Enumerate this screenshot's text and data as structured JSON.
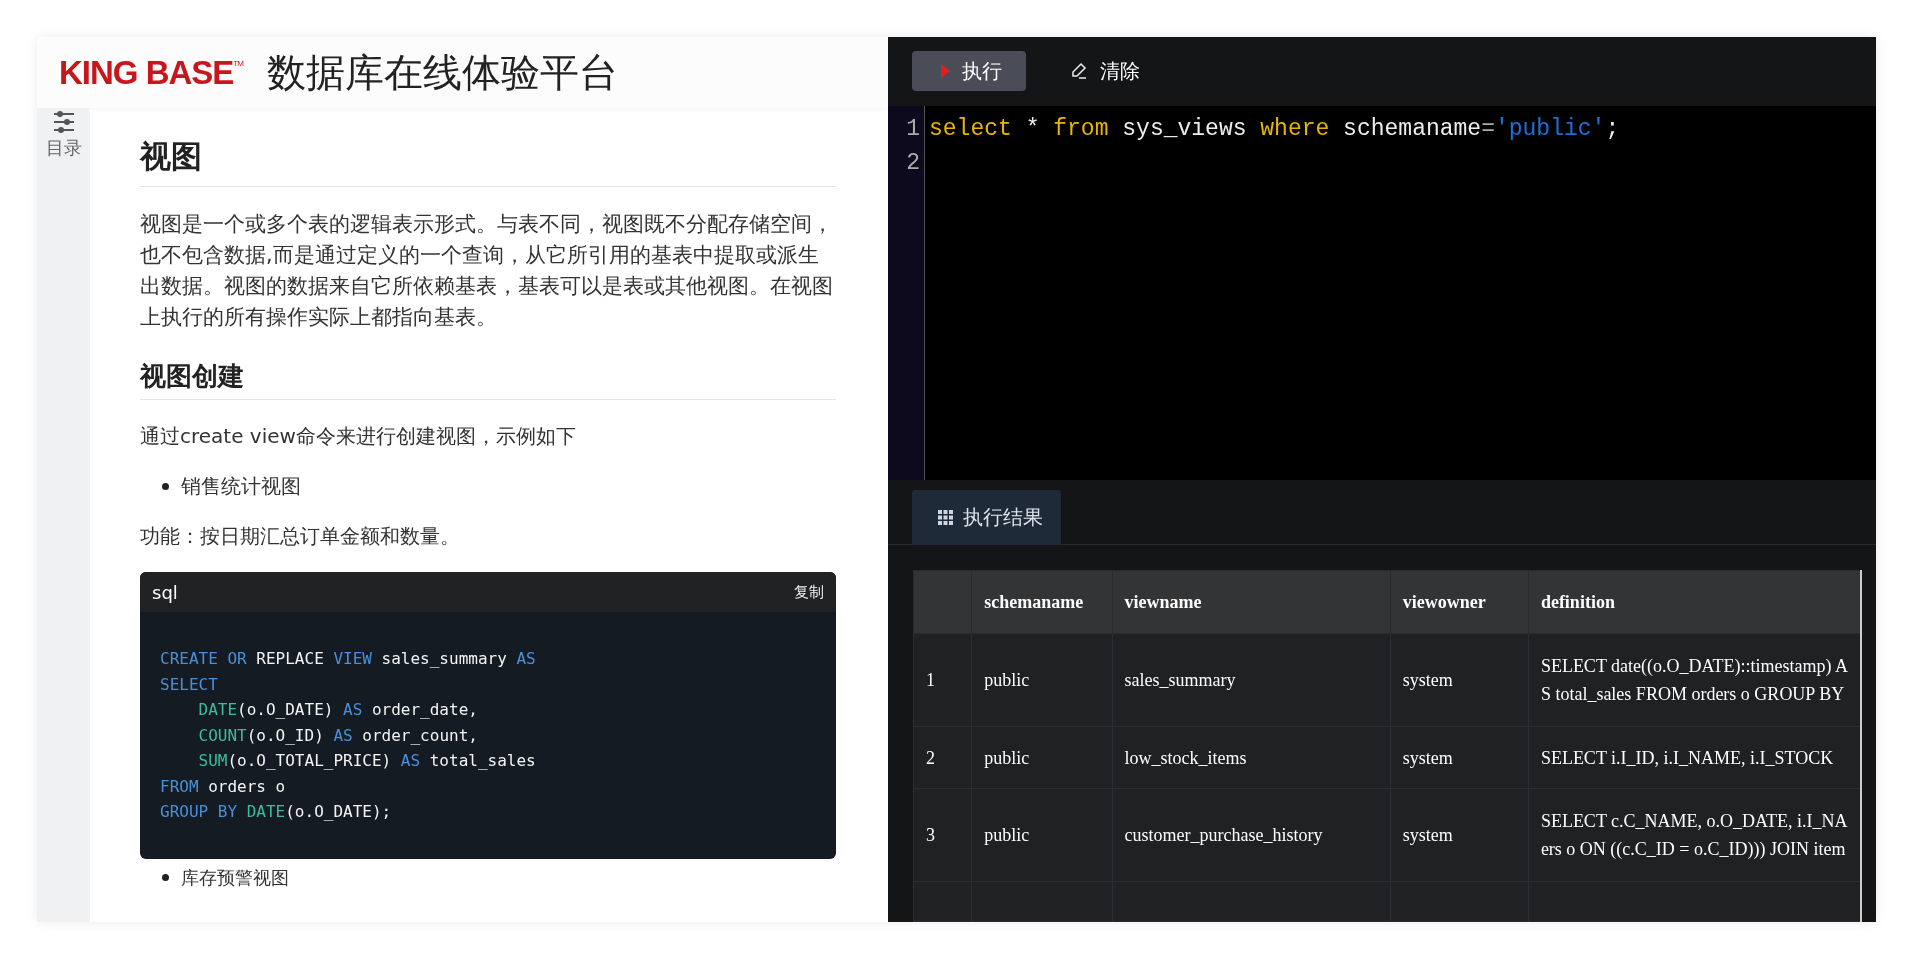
{
  "header": {
    "logo": "KING BASE$^{TM}$",
    "title": "数据库在线体验平台"
  },
  "sidebar": {
    "label": "目录"
  },
  "doc": {
    "heading": "视图",
    "paragraph": "视图是一个或多个表的逻辑表示形式。与表不同，视图既不分配存储空间，也不包含数据,而是通过定义的一个查询，从它所引用的基表中提取或派生出数据。视图的数据来自它所依赖基表，基表可以是表或其他视图。在视图上执行的所有操作实际上都指向基表。",
    "subheading": "视图创建",
    "intro": "通过create view命令来进行创建视图，示例如下",
    "bullet": "销售统计视图",
    "function_text": "功能：按日期汇总订单金额和数量。",
    "code_block": {
      "language": "sql",
      "copy_label": "复制",
      "lines": [
        [
          {
            "kind": "keyword",
            "text": "CREATE OR "
          },
          {
            "kind": "plain",
            "text": "REPLACE "
          },
          {
            "kind": "keyword",
            "text": "VIEW "
          },
          {
            "kind": "plain",
            "text": "sales_summary "
          },
          {
            "kind": "keyword",
            "text": "AS"
          }
        ],
        [
          {
            "kind": "keyword",
            "text": "SELECT"
          }
        ],
        [
          {
            "kind": "func",
            "text": "DATE",
            "indent": true
          },
          {
            "kind": "plain",
            "text": "(o.O_DATE) "
          },
          {
            "kind": "keyword",
            "text": "AS "
          },
          {
            "kind": "plain",
            "text": "order_date,"
          }
        ],
        [
          {
            "kind": "func",
            "text": "COUNT",
            "indent": true
          },
          {
            "kind": "plain",
            "text": "(o.O_ID) "
          },
          {
            "kind": "keyword",
            "text": "AS "
          },
          {
            "kind": "plain",
            "text": "order_count,"
          }
        ],
        [
          {
            "kind": "func",
            "text": "SUM",
            "indent": true
          },
          {
            "kind": "plain",
            "text": "(o.O_TOTAL_PRICE) "
          },
          {
            "kind": "keyword",
            "text": "AS "
          },
          {
            "kind": "plain",
            "text": "total_sales"
          }
        ],
        [
          {
            "kind": "keyword",
            "text": "FROM "
          },
          {
            "kind": "plain",
            "text": "orders o"
          }
        ],
        [
          {
            "kind": "keyword",
            "text": "GROUP BY "
          },
          {
            "kind": "func",
            "text": "DATE"
          },
          {
            "kind": "plain",
            "text": "(o.O_DATE);"
          }
        ]
      ]
    },
    "next_bullet": "库存预警视图"
  },
  "toolbar": {
    "buttons": [
      {
        "label": "执行",
        "kind": "run"
      },
      {
        "label": "清除",
        "kind": "clear"
      }
    ]
  },
  "editor": {
    "lines": [
      {
        "number": "1",
        "tokens": [
          {
            "kind": "keyword",
            "text": "select"
          },
          {
            "kind": "plain",
            "text": " * "
          },
          {
            "kind": "keyword",
            "text": "from"
          },
          {
            "kind": "plain",
            "text": " sys_views "
          },
          {
            "kind": "keyword",
            "text": "where"
          },
          {
            "kind": "plain",
            "text": " schemaname"
          },
          {
            "kind": "operator",
            "text": "="
          },
          {
            "kind": "string",
            "text": "'public'"
          },
          {
            "kind": "plain",
            "text": ";"
          }
        ]
      },
      {
        "number": "2"
      }
    ]
  },
  "results": {
    "tab": "执行结果",
    "table": {
      "columns": [
        "schemaname",
        "viewname",
        "viewowner",
        "definition"
      ],
      "rows": [
        {
          "index": "1",
          "schemaname": "public",
          "viewname": "sales_summary",
          "viewowner": "system",
          "definition": [
            "SELECT date((o.O_DATE)::timestamp) A",
            "S total_sales FROM orders o GROUP BY"
          ]
        },
        {
          "index": "2",
          "schemaname": "public",
          "viewname": "low_stock_items",
          "viewowner": "system",
          "definition": [
            "SELECT i.I_ID, i.I_NAME, i.I_STOCK"
          ]
        },
        {
          "index": "3",
          "schemaname": "public",
          "viewname": "customer_purchase_history",
          "viewowner": "system",
          "definition": [
            "SELECT c.C_NAME, o.O_DATE, i.I_NA",
            "ers o ON ((c.C_ID = o.C_ID))) JOIN item"
          ]
        }
      ]
    }
  }
}
